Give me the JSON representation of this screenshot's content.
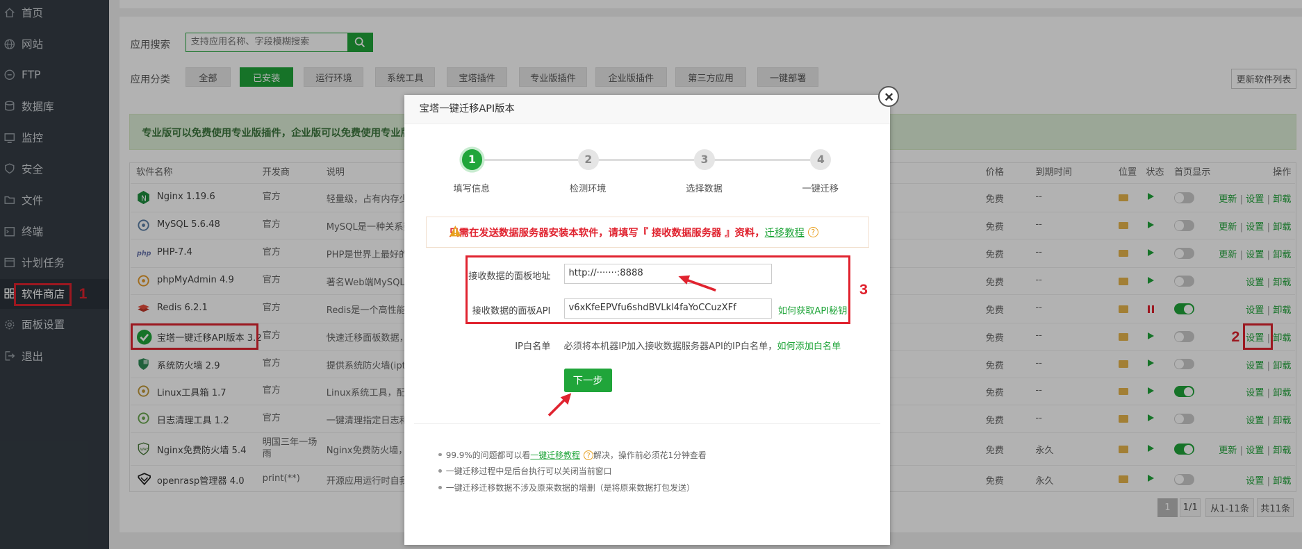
{
  "sidebar": {
    "items": [
      {
        "label": "首页",
        "icon": "home-icon"
      },
      {
        "label": "网站",
        "icon": "globe-icon"
      },
      {
        "label": "FTP",
        "icon": "ftp-icon"
      },
      {
        "label": "数据库",
        "icon": "database-icon"
      },
      {
        "label": "监控",
        "icon": "monitor-icon"
      },
      {
        "label": "安全",
        "icon": "shield-icon"
      },
      {
        "label": "文件",
        "icon": "folder-icon"
      },
      {
        "label": "终端",
        "icon": "terminal-icon"
      },
      {
        "label": "计划任务",
        "icon": "calendar-icon"
      },
      {
        "label": "软件商店",
        "icon": "grid-icon"
      },
      {
        "label": "面板设置",
        "icon": "gear-icon"
      },
      {
        "label": "退出",
        "icon": "logout-icon"
      }
    ],
    "active_index": 9
  },
  "annotations": {
    "n1": "1",
    "n2": "2",
    "n3": "3"
  },
  "filters": {
    "search_label": "应用搜索",
    "search_placeholder": "支持应用名称、字段模糊搜索",
    "category_label": "应用分类",
    "categories": [
      "全部",
      "已安装",
      "运行环境",
      "系统工具",
      "宝塔插件",
      "专业版插件",
      "企业版插件",
      "第三方应用",
      "一键部署"
    ],
    "active_category": "已安装",
    "update_list_button": "更新软件列表"
  },
  "notice": "专业版可以免费使用专业版插件，企业版可以免费使用专业版及企",
  "table": {
    "headers": {
      "name": "软件名称",
      "dev": "开发商",
      "desc": "说明",
      "price": "价格",
      "expire": "到期时间",
      "location": "位置",
      "status": "状态",
      "homepage": "首页显示",
      "ops": "操作"
    },
    "rows": [
      {
        "name": "Nginx 1.19.6",
        "dev": "官方",
        "desc": "轻量级，占有内存少，",
        "price": "免费",
        "expire": "--",
        "running": true,
        "homepage": false,
        "ops": [
          "更新",
          "设置",
          "卸载"
        ]
      },
      {
        "name": "MySQL 5.6.48",
        "dev": "官方",
        "desc": "MySQL是一种关系数",
        "price": "免费",
        "expire": "--",
        "running": true,
        "homepage": false,
        "ops": [
          "更新",
          "设置",
          "卸载"
        ]
      },
      {
        "name": "PHP-7.4",
        "dev": "官方",
        "desc": "PHP是世界上最好的",
        "price": "免费",
        "expire": "--",
        "running": true,
        "homepage": false,
        "ops": [
          "更新",
          "设置",
          "卸载"
        ]
      },
      {
        "name": "phpMyAdmin 4.9",
        "dev": "官方",
        "desc": "著名Web端MySQL管",
        "price": "免费",
        "expire": "--",
        "running": true,
        "homepage": false,
        "ops": [
          "设置",
          "卸载"
        ]
      },
      {
        "name": "Redis 6.2.1",
        "dev": "官方",
        "desc": "Redis是一个高性能的",
        "price": "免费",
        "expire": "--",
        "running": false,
        "homepage": true,
        "ops": [
          "设置",
          "卸载"
        ]
      },
      {
        "name": "宝塔一键迁移API版本 3.2",
        "dev": "官方",
        "desc": "快速迁移面板数据，",
        "price": "免费",
        "expire": "--",
        "running": true,
        "homepage": false,
        "ops": [
          "设置",
          "卸载"
        ]
      },
      {
        "name": "系统防火墙 2.9",
        "dev": "官方",
        "desc": "提供系统防火墙(iptal",
        "price": "免费",
        "expire": "--",
        "running": true,
        "homepage": false,
        "ops": [
          "设置",
          "卸载"
        ]
      },
      {
        "name": "Linux工具箱 1.7",
        "dev": "官方",
        "desc": "Linux系统工具，配置",
        "price": "免费",
        "expire": "--",
        "running": true,
        "homepage": true,
        "ops": [
          "设置",
          "卸载"
        ]
      },
      {
        "name": "日志清理工具 1.2",
        "dev": "官方",
        "desc": "一键清理指定日志和",
        "price": "免费",
        "expire": "--",
        "running": true,
        "homepage": false,
        "ops": [
          "设置",
          "卸载"
        ]
      },
      {
        "name": "Nginx免费防火墙 5.4",
        "dev": "明国三年一场雨",
        "desc": "Nginx免费防火墙，",
        "price": "免费",
        "expire": "永久",
        "running": true,
        "homepage": true,
        "ops": [
          "更新",
          "设置",
          "卸载"
        ]
      },
      {
        "name": "openrasp管理器 4.0",
        "dev": "print(**)",
        "desc": "开源应用运行时自我仍",
        "price": "免费",
        "expire": "永久",
        "running": true,
        "homepage": false,
        "ops": [
          "设置",
          "卸载"
        ]
      }
    ]
  },
  "pagination": {
    "current": "1",
    "pages": "1/1",
    "range": "从1-11条",
    "total": "共11条"
  },
  "modal": {
    "title": "宝塔一键迁移API版本",
    "steps": [
      {
        "num": "1",
        "label": "填写信息"
      },
      {
        "num": "2",
        "label": "检测环境"
      },
      {
        "num": "3",
        "label": "选择数据"
      },
      {
        "num": "4",
        "label": "一键迁移"
      }
    ],
    "warning_text": "只需在发送数据服务器安装本软件，请填写『 接收数据服务器 』资料，",
    "warning_link": "迁移教程",
    "panel_url_label": "接收数据的面板地址",
    "panel_url_value": "http://·······:8888",
    "api_label": "接收数据的面板API",
    "api_value": "v6xKfeEPVfu6shdBVLkl4faYoCCuzXFf",
    "api_help_link": "如何获取API秘钥",
    "ip_label": "IP白名单",
    "ip_text": "必须将本机器IP加入接收数据服务器API的IP白名单，",
    "ip_link": "如何添加白名单",
    "next_button": "下一步",
    "tips": {
      "t1_pre": "99.9%的问题都可以看",
      "t1_link": "一键迁移教程",
      "t1_post": "解决，操作前必须花1分钟查看",
      "t2": "一键迁移过程中是后台执行可以关闭当前窗口",
      "t3": "一键迁移迁移数据不涉及原来数据的增删（是将原来数据打包发送）"
    }
  },
  "colors": {
    "brand_green": "#20a53a",
    "annotation_red": "#e0232f",
    "sidebar_bg": "#353d45"
  }
}
